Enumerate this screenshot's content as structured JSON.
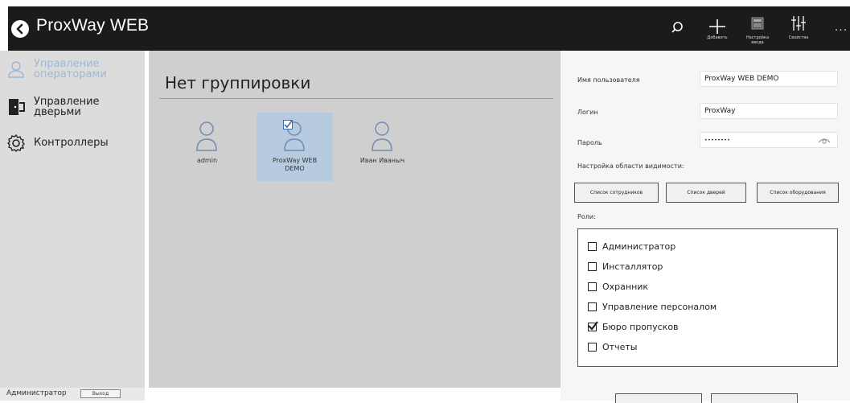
{
  "header": {
    "app_title": "ProxWay WEB",
    "actions": {
      "search_icon": "search-icon",
      "add_label": "Добавить",
      "input_settings_label": "Настройка ввода",
      "properties_label": "Свойства",
      "more_label": "..."
    }
  },
  "sidebar": {
    "items": [
      {
        "label": "Управление операторами",
        "icon": "operators-icon",
        "active": true
      },
      {
        "label": "Управление дверьми",
        "icon": "door-icon",
        "active": false
      },
      {
        "label": "Контроллеры",
        "icon": "gear-icon",
        "active": false
      }
    ],
    "footer": {
      "role": "Администратор",
      "logout_label": "Выход"
    }
  },
  "main": {
    "group_title": "Нет группировки",
    "users": [
      {
        "name": "admin",
        "selected": false
      },
      {
        "name": "ProxWay WEB DEMO",
        "selected": true
      },
      {
        "name": "Иван Иваныч",
        "selected": false
      }
    ]
  },
  "form": {
    "username_label": "Имя пользователя",
    "username_value": "ProxWay WEB DEMO",
    "login_label": "Логин",
    "login_value": "ProxWay",
    "password_label": "Пароль",
    "password_value": "••••••••",
    "visibility_label": "Настройка области видимости:",
    "list_buttons": [
      "Список сотрудников",
      "Список дверей",
      "Список оборудования"
    ],
    "roles_label": "Роли:",
    "roles": [
      {
        "label": "Администратор",
        "checked": false
      },
      {
        "label": "Инсталлятор",
        "checked": false
      },
      {
        "label": "Охранник",
        "checked": false
      },
      {
        "label": "Управление персоналом",
        "checked": false
      },
      {
        "label": "Бюро пропусков",
        "checked": true
      },
      {
        "label": "Отчеты",
        "checked": false
      }
    ]
  },
  "colors": {
    "header_bg": "#1b1b1b",
    "sidebar_bg": "#dcdcdc",
    "main_bg": "#cfcfcf",
    "selected_tile": "#b7cbe0",
    "active_nav_text": "#9fb7d3",
    "panel_bg": "#f6f6f6"
  }
}
